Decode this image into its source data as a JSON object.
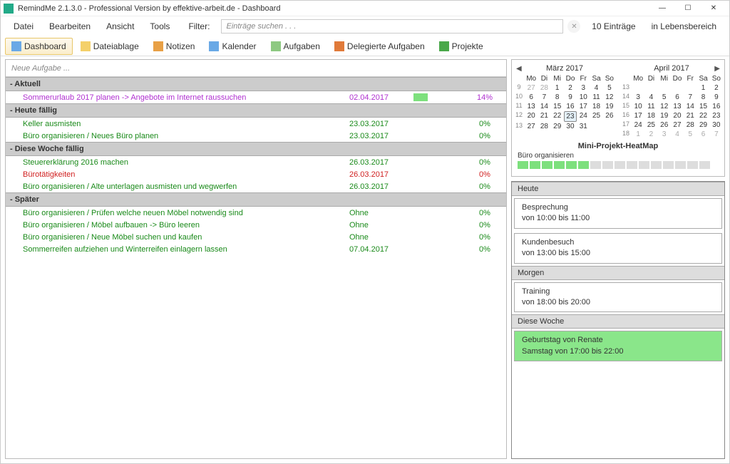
{
  "window": {
    "title": "RemindMe 2.1.3.0 - Professional Version by effektive-arbeit.de - Dashboard"
  },
  "menu": {
    "datei": "Datei",
    "bearbeiten": "Bearbeiten",
    "ansicht": "Ansicht",
    "tools": "Tools",
    "filter": "Filter:"
  },
  "search": {
    "placeholder": "Einträge suchen . . ."
  },
  "status": {
    "entries": "10 Einträge",
    "area": "in Lebensbereich"
  },
  "tabs": {
    "dashboard": "Dashboard",
    "dateiablage": "Dateiablage",
    "notizen": "Notizen",
    "kalender": "Kalender",
    "aufgaben": "Aufgaben",
    "delegierte": "Delegierte Aufgaben",
    "projekte": "Projekte"
  },
  "newTask": "Neue Aufgabe ...",
  "groups": {
    "aktuell": "- Aktuell",
    "heute": "- Heute fällig",
    "woche": "- Diese Woche fällig",
    "spaeter": "- Später"
  },
  "tasks": {
    "aktuell": [
      {
        "name": "Sommerurlaub 2017 planen -> Angebote im Internet raussuchen",
        "date": "02.04.2017",
        "pct": "14%",
        "cls": "purple",
        "hasBar": true
      }
    ],
    "heute": [
      {
        "name": "Keller ausmisten",
        "date": "23.03.2017",
        "pct": "0%",
        "cls": "green"
      },
      {
        "name": "Büro organisieren / Neues Büro planen",
        "date": "23.03.2017",
        "pct": "0%",
        "cls": "green"
      }
    ],
    "woche": [
      {
        "name": "Steuererklärung 2016 machen",
        "date": "26.03.2017",
        "pct": "0%",
        "cls": "green"
      },
      {
        "name": "Bürotätigkeiten",
        "date": "26.03.2017",
        "pct": "0%",
        "cls": "red"
      },
      {
        "name": "Büro organisieren / Alte unterlagen ausmisten und wegwerfen",
        "date": "26.03.2017",
        "pct": "0%",
        "cls": "green"
      }
    ],
    "spaeter": [
      {
        "name": "Büro organisieren / Prüfen welche neuen Möbel notwendig sind",
        "date": "Ohne",
        "pct": "0%",
        "cls": "green"
      },
      {
        "name": "Büro organisieren / Möbel aufbauen -> Büro leeren",
        "date": "Ohne",
        "pct": "0%",
        "cls": "green"
      },
      {
        "name": "Büro organisieren / Neue Möbel suchen und kaufen",
        "date": "Ohne",
        "pct": "0%",
        "cls": "green"
      },
      {
        "name": "Sommerreifen aufziehen und Winterreifen einlagern lassen",
        "date": "07.04.2017",
        "pct": "0%",
        "cls": "green"
      }
    ]
  },
  "calendar": {
    "month1": {
      "title": "März 2017",
      "dayHeaders": [
        "Mo",
        "Di",
        "Mi",
        "Do",
        "Fr",
        "Sa",
        "So"
      ],
      "weeks": [
        {
          "wn": "9",
          "days": [
            {
              "n": "27",
              "o": true
            },
            {
              "n": "28",
              "o": true
            },
            {
              "n": "1"
            },
            {
              "n": "2"
            },
            {
              "n": "3"
            },
            {
              "n": "4"
            },
            {
              "n": "5"
            }
          ]
        },
        {
          "wn": "10",
          "days": [
            {
              "n": "6"
            },
            {
              "n": "7"
            },
            {
              "n": "8"
            },
            {
              "n": "9"
            },
            {
              "n": "10"
            },
            {
              "n": "11"
            },
            {
              "n": "12"
            }
          ]
        },
        {
          "wn": "11",
          "days": [
            {
              "n": "13"
            },
            {
              "n": "14"
            },
            {
              "n": "15"
            },
            {
              "n": "16"
            },
            {
              "n": "17"
            },
            {
              "n": "18"
            },
            {
              "n": "19"
            }
          ]
        },
        {
          "wn": "12",
          "days": [
            {
              "n": "20"
            },
            {
              "n": "21"
            },
            {
              "n": "22"
            },
            {
              "n": "23",
              "t": true
            },
            {
              "n": "24"
            },
            {
              "n": "25"
            },
            {
              "n": "26"
            }
          ]
        },
        {
          "wn": "13",
          "days": [
            {
              "n": "27"
            },
            {
              "n": "28"
            },
            {
              "n": "29"
            },
            {
              "n": "30"
            },
            {
              "n": "31"
            },
            {
              "n": ""
            },
            {
              "n": ""
            }
          ]
        }
      ]
    },
    "month2": {
      "title": "April 2017",
      "dayHeaders": [
        "Mo",
        "Di",
        "Mi",
        "Do",
        "Fr",
        "Sa",
        "So"
      ],
      "weeks": [
        {
          "wn": "13",
          "days": [
            {
              "n": ""
            },
            {
              "n": ""
            },
            {
              "n": ""
            },
            {
              "n": ""
            },
            {
              "n": ""
            },
            {
              "n": "1"
            },
            {
              "n": "2"
            }
          ]
        },
        {
          "wn": "14",
          "days": [
            {
              "n": "3"
            },
            {
              "n": "4"
            },
            {
              "n": "5"
            },
            {
              "n": "6"
            },
            {
              "n": "7"
            },
            {
              "n": "8"
            },
            {
              "n": "9"
            }
          ]
        },
        {
          "wn": "15",
          "days": [
            {
              "n": "10"
            },
            {
              "n": "11"
            },
            {
              "n": "12"
            },
            {
              "n": "13"
            },
            {
              "n": "14"
            },
            {
              "n": "15"
            },
            {
              "n": "16"
            }
          ]
        },
        {
          "wn": "16",
          "days": [
            {
              "n": "17"
            },
            {
              "n": "18"
            },
            {
              "n": "19"
            },
            {
              "n": "20"
            },
            {
              "n": "21"
            },
            {
              "n": "22"
            },
            {
              "n": "23"
            }
          ]
        },
        {
          "wn": "17",
          "days": [
            {
              "n": "24"
            },
            {
              "n": "25"
            },
            {
              "n": "26"
            },
            {
              "n": "27"
            },
            {
              "n": "28"
            },
            {
              "n": "29"
            },
            {
              "n": "30"
            }
          ]
        },
        {
          "wn": "18",
          "days": [
            {
              "n": "1",
              "o": true
            },
            {
              "n": "2",
              "o": true
            },
            {
              "n": "3",
              "o": true
            },
            {
              "n": "4",
              "o": true
            },
            {
              "n": "5",
              "o": true
            },
            {
              "n": "6",
              "o": true
            },
            {
              "n": "7",
              "o": true
            }
          ]
        }
      ]
    }
  },
  "heatmap": {
    "title": "Mini-Projekt-HeatMap",
    "label": "Büro organisieren",
    "cells": [
      "g",
      "g",
      "g",
      "g",
      "g",
      "g",
      "e",
      "e",
      "e",
      "e",
      "e",
      "e",
      "e",
      "e",
      "e",
      "e"
    ]
  },
  "side": {
    "heute": {
      "hdr": "Heute",
      "items": [
        {
          "t": "Besprechung",
          "s": "von 10:00 bis 11:00"
        },
        {
          "t": "Kundenbesuch",
          "s": "von 13:00 bis 15:00"
        }
      ]
    },
    "morgen": {
      "hdr": "Morgen",
      "items": [
        {
          "t": "Training",
          "s": "von 18:00 bis 20:00"
        }
      ]
    },
    "woche": {
      "hdr": "Diese Woche",
      "items": [
        {
          "t": "Geburtstag von Renate",
          "s": "Samstag von 17:00 bis 22:00",
          "hl": true
        }
      ]
    }
  }
}
